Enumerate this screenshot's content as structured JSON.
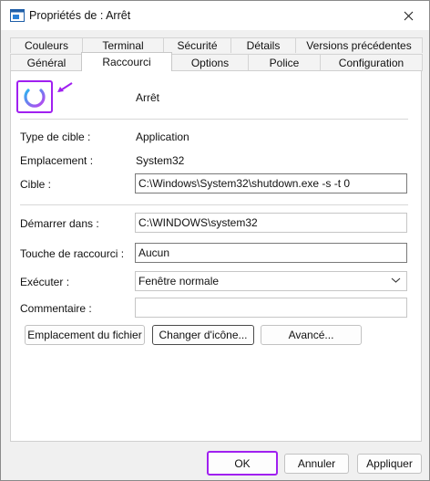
{
  "window": {
    "title": "Propriétés de : Arrêt",
    "title_icon": "shortcut-window-icon"
  },
  "tabs": {
    "row1": [
      "Couleurs",
      "Terminal",
      "Sécurité",
      "Détails",
      "Versions précédentes"
    ],
    "row2": [
      "Général",
      "Raccourci",
      "Options",
      "Police",
      "Configuration"
    ],
    "active": "Raccourci"
  },
  "header": {
    "name": "Arrêt",
    "icon": "power-icon"
  },
  "info": {
    "target_type_label": "Type de cible :",
    "target_type_value": "Application",
    "location_label": "Emplacement :",
    "location_value": "System32"
  },
  "fields": {
    "target_label": "Cible :",
    "target_value": "C:\\Windows\\System32\\shutdown.exe -s -t 0",
    "start_in_label": "Démarrer dans :",
    "start_in_value": "C:\\WINDOWS\\system32",
    "shortcut_key_label": "Touche de raccourci :",
    "shortcut_key_value": "Aucun",
    "run_label": "Exécuter :",
    "run_value": "Fenêtre normale",
    "comment_label": "Commentaire :",
    "comment_value": ""
  },
  "buttons": {
    "open_location": "Emplacement du fichier",
    "change_icon": "Changer d'icône...",
    "advanced": "Avancé...",
    "ok": "OK",
    "cancel": "Annuler",
    "apply": "Appliquer"
  },
  "colors": {
    "highlight": "#a020f0",
    "power_gradient_start": "#2bb3f0",
    "power_gradient_end": "#c040f0"
  }
}
